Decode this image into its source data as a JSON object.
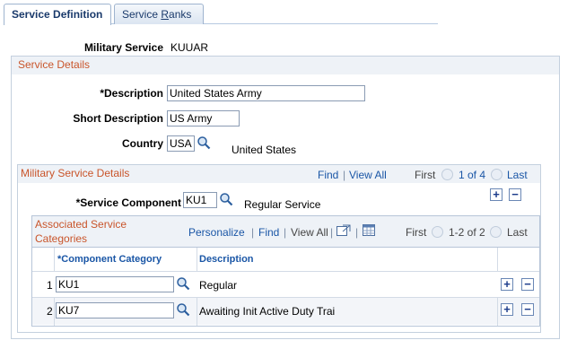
{
  "tabs": [
    {
      "label": "Service Definition",
      "active": true
    },
    {
      "label_prefix": "Service ",
      "label_underline": "R",
      "label_suffix": "anks",
      "active": false
    }
  ],
  "header": {
    "military_service_label": "Military Service",
    "military_service_value": "KUUAR"
  },
  "service_details": {
    "title": "Service Details",
    "description_label": "*Description",
    "description_value": "United States Army",
    "short_description_label": "Short Description",
    "short_description_value": "US Army",
    "country_label": "Country",
    "country_value": "USA",
    "country_name": "United States"
  },
  "military_service_details": {
    "title": "Military Service Details",
    "nav": {
      "find": "Find",
      "sep": "|",
      "view_all": "View All",
      "first": "First",
      "count": "1 of 4",
      "last": "Last"
    },
    "service_component_label": "*Service Component",
    "service_component_value": "KU1",
    "service_component_desc": "Regular Service"
  },
  "associated_categories": {
    "title_line1": "Associated Service",
    "title_line2": "Categories",
    "toolbar": {
      "personalize": "Personalize",
      "find": "Find",
      "view_all": "View All",
      "first": "First",
      "count": "1-2 of 2",
      "last": "Last",
      "sep": "|"
    },
    "columns": [
      "*Component Category",
      "Description"
    ],
    "rows": [
      {
        "num": "1",
        "category": "KU1",
        "description": "Regular"
      },
      {
        "num": "2",
        "category": "KU7",
        "description": "Awaiting Init Active Duty Trai"
      }
    ]
  },
  "icons": {
    "lookup": "magnifier-lookup-icon",
    "add": "+",
    "remove": "−"
  },
  "colors": {
    "tab_text": "#1a3a6b",
    "section_title": "#c9552b",
    "link": "#1a56a6",
    "border": "#c4d0de"
  }
}
